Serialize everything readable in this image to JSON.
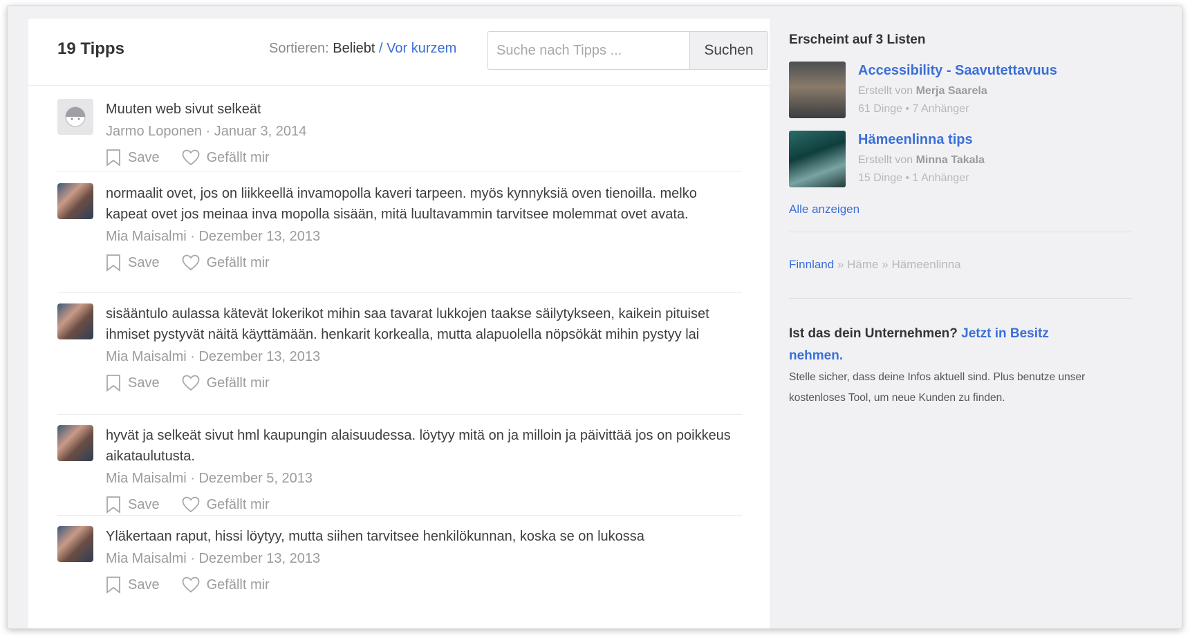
{
  "header": {
    "count_label": "19 Tipps",
    "sort_label": "Sortieren:",
    "sort_popular": "Beliebt",
    "sort_sep": "/",
    "sort_recent": "Vor kurzem",
    "search_placeholder": "Suche nach Tipps ...",
    "search_button": "Suchen"
  },
  "actions": {
    "save": "Save",
    "like": "Gefällt mir"
  },
  "tips": [
    {
      "text": "Muuten web sivut selkeät",
      "author": "Jarmo Loponen",
      "sep": "·",
      "date": "Januar 3, 2014",
      "avatar": "default-avatar"
    },
    {
      "text": "normaalit ovet, jos on liikkeellä invamopolla kaveri tarpeen. myös kynnyksiä oven tienoilla. melko kapeat ovet jos meinaa inva mopolla sisään, mitä luultavammin tarvitsee molemmat ovet avata.",
      "author": "Mia Maisalmi",
      "sep": "·",
      "date": "Dezember 13, 2013",
      "avatar": "user-photo"
    },
    {
      "text": "sisääntulo aulassa kätevät lokerikot mihin saa tavarat lukkojen taakse säilytykseen, kaikein pituiset ihmiset pystyvät näitä käyttämään. henkarit korkealla, mutta alapuolella nöpsökät mihin pystyy lai",
      "author": "Mia Maisalmi",
      "sep": "·",
      "date": "Dezember 13, 2013",
      "avatar": "user-photo"
    },
    {
      "text": "hyvät ja selkeät sivut hml kaupungin alaisuudessa. löytyy mitä on ja milloin ja päivittää jos on poikkeus aikataulutusta.",
      "author": "Mia Maisalmi",
      "sep": "·",
      "date": "Dezember 5, 2013",
      "avatar": "user-photo"
    },
    {
      "text": "Yläkertaan raput, hissi löytyy, mutta siihen tarvitsee henkilökunnan, koska se on lukossa",
      "author": "Mia Maisalmi",
      "sep": "·",
      "date": "Dezember 13, 2013",
      "avatar": "user-photo"
    }
  ],
  "sidebar": {
    "lists_title": "Erscheint auf 3 Listen",
    "lists": [
      {
        "name": "Accessibility - Saavutettavuus",
        "by_prefix": "Erstellt von",
        "by_name": "Merja Saarela",
        "stats": "61 Dinge • 7 Anhänger"
      },
      {
        "name": "Hämeenlinna tips",
        "by_prefix": "Erstellt von",
        "by_name": "Minna Takala",
        "stats": "15 Dinge • 1 Anhänger"
      }
    ],
    "show_all": "Alle anzeigen",
    "breadcrumb": {
      "country": "Finnland",
      "sep": "»",
      "region": "Häme",
      "city": "Hämeenlinna"
    },
    "claim": {
      "question": "Ist das dein Unternehmen?",
      "link": "Jetzt in Besitz nehmen.",
      "description": "Stelle sicher, dass deine Infos aktuell sind. Plus benutze unser kostenloses Tool, um neue Kunden zu finden."
    }
  },
  "colors": {
    "link": "#3a6fd8",
    "sidebar_bg": "#f1f1f4",
    "muted": "#9c9c9c"
  }
}
